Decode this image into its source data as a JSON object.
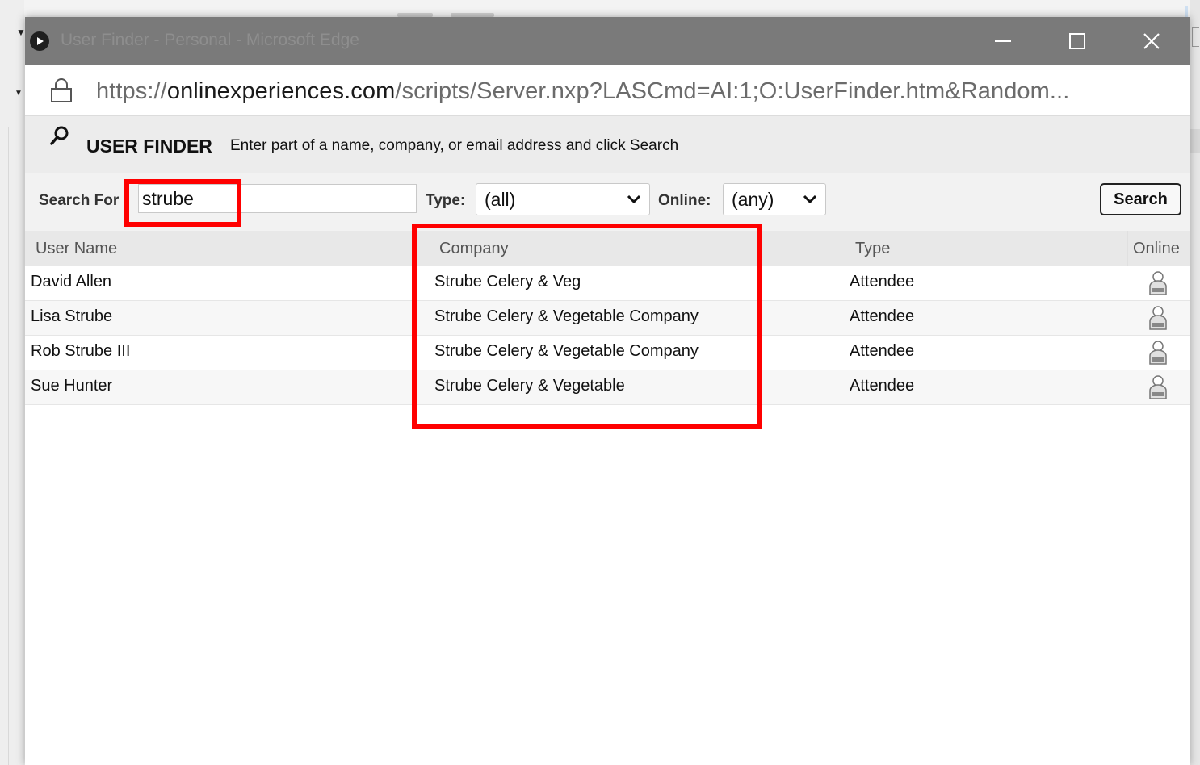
{
  "window": {
    "title": "User Finder - Personal - Microsoft Edge",
    "url_scheme": "https://",
    "url_host": "onlinexperiences.com",
    "url_path": "/scripts/Server.nxp?LASCmd=AI:1;O:UserFinder.htm&Random..."
  },
  "finder": {
    "title": "USER FINDER",
    "hint": "Enter part of a name, company, or email address and click Search"
  },
  "filters": {
    "search_label": "Search For",
    "search_value": "strube",
    "type_label": "Type:",
    "type_value": "(all)",
    "online_label": "Online:",
    "online_value": "(any)",
    "search_button": "Search"
  },
  "table": {
    "headers": {
      "user_name": "User Name",
      "company": "Company",
      "type": "Type",
      "online": "Online"
    },
    "rows": [
      {
        "user_name": "David Allen",
        "company": "Strube Celery & Veg",
        "type": "Attendee",
        "online_icon": "offline-user-icon"
      },
      {
        "user_name": "Lisa Strube",
        "company": "Strube Celery & Vegetable Company",
        "type": "Attendee",
        "online_icon": "offline-user-icon"
      },
      {
        "user_name": "Rob Strube III",
        "company": "Strube Celery & Vegetable Company",
        "type": "Attendee",
        "online_icon": "offline-user-icon"
      },
      {
        "user_name": "Sue Hunter",
        "company": "Strube Celery & Vegetable",
        "type": "Attendee",
        "online_icon": "offline-user-icon"
      }
    ]
  },
  "colors": {
    "titlebar": "#7a7a7a",
    "annotation": "#ff0000"
  }
}
